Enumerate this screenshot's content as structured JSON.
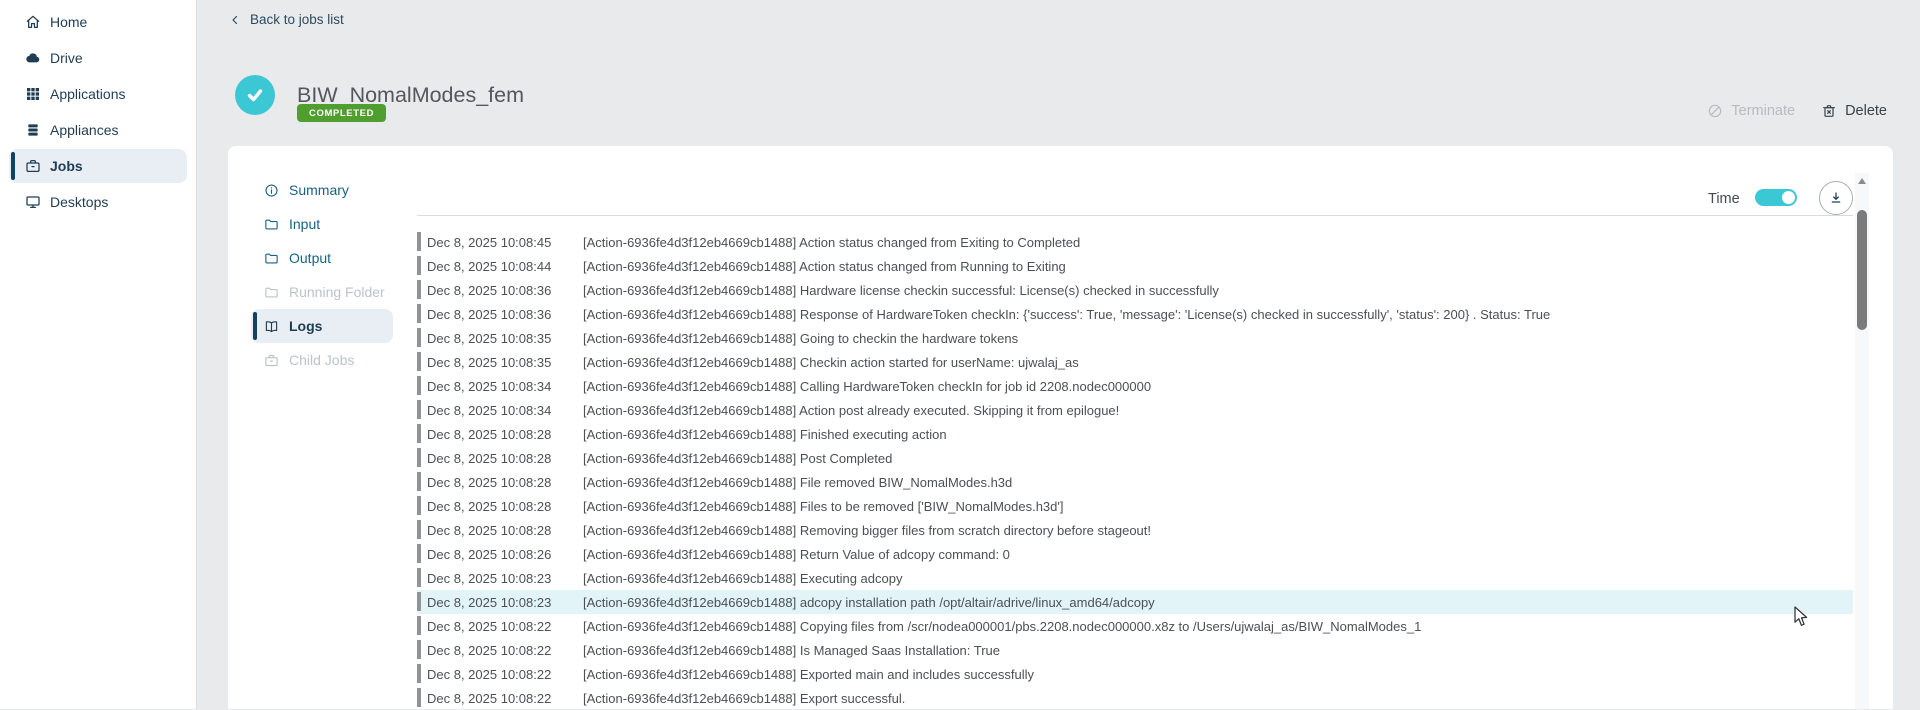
{
  "colors": {
    "accent_teal": "#3cc7d5",
    "badge_green": "#509e2f",
    "nav_navy": "#1f3d54",
    "subnav_link": "#186284",
    "disabled_gray": "#bcc3c9",
    "row_highlight": "#e2f4f7",
    "page_background": "#e9eaeb"
  },
  "sidebar": {
    "items": [
      {
        "label": "Home",
        "icon": "home-icon",
        "active": false
      },
      {
        "label": "Drive",
        "icon": "cloud-icon",
        "active": false
      },
      {
        "label": "Applications",
        "icon": "grid-icon",
        "active": false
      },
      {
        "label": "Appliances",
        "icon": "stack-icon",
        "active": false
      },
      {
        "label": "Jobs",
        "icon": "briefcase-icon",
        "active": true
      },
      {
        "label": "Desktops",
        "icon": "monitor-icon",
        "active": false
      }
    ]
  },
  "breadcrumb": {
    "back_label": "Back to jobs list"
  },
  "job_header": {
    "title": "BIW_NomalModes_fem",
    "status": "COMPLETED",
    "status_icon": "check-circle-icon"
  },
  "actions": {
    "terminate_label": "Terminate",
    "delete_label": "Delete"
  },
  "subnav": {
    "items": [
      {
        "label": "Summary",
        "icon": "info-icon",
        "active": false,
        "disabled": false
      },
      {
        "label": "Input",
        "icon": "folder-icon",
        "active": false,
        "disabled": false
      },
      {
        "label": "Output",
        "icon": "folder-icon",
        "active": false,
        "disabled": false
      },
      {
        "label": "Running Folder",
        "icon": "folder-icon",
        "active": false,
        "disabled": true
      },
      {
        "label": "Logs",
        "icon": "book-icon",
        "active": true,
        "disabled": false
      },
      {
        "label": "Child Jobs",
        "icon": "briefcase-icon",
        "active": false,
        "disabled": true
      }
    ]
  },
  "toolbar": {
    "time_label": "Time",
    "time_toggle_on": true,
    "download_icon": "download-icon"
  },
  "logs": [
    {
      "timestamp": "Dec 8, 2025 10:08:45",
      "message": "[Action-6936fe4d3f12eb4669cb1488] Action status changed from Exiting to Completed",
      "highlighted": false
    },
    {
      "timestamp": "Dec 8, 2025 10:08:44",
      "message": "[Action-6936fe4d3f12eb4669cb1488] Action status changed from Running to Exiting",
      "highlighted": false
    },
    {
      "timestamp": "Dec 8, 2025 10:08:36",
      "message": "[Action-6936fe4d3f12eb4669cb1488] Hardware license checkin successful: License(s) checked in successfully",
      "highlighted": false
    },
    {
      "timestamp": "Dec 8, 2025 10:08:36",
      "message": "[Action-6936fe4d3f12eb4669cb1488] Response of HardwareToken checkIn: {'success': True, 'message': 'License(s) checked in successfully', 'status': 200} . Status:  True",
      "highlighted": false
    },
    {
      "timestamp": "Dec 8, 2025 10:08:35",
      "message": "[Action-6936fe4d3f12eb4669cb1488] Going to checkin the hardware tokens",
      "highlighted": false
    },
    {
      "timestamp": "Dec 8, 2025 10:08:35",
      "message": "[Action-6936fe4d3f12eb4669cb1488] Checkin action started for userName: ujwalaj_as",
      "highlighted": false
    },
    {
      "timestamp": "Dec 8, 2025 10:08:34",
      "message": "[Action-6936fe4d3f12eb4669cb1488] Calling HardwareToken checkIn for job id 2208.nodec000000",
      "highlighted": false
    },
    {
      "timestamp": "Dec 8, 2025 10:08:34",
      "message": "[Action-6936fe4d3f12eb4669cb1488] Action post already executed. Skipping it from epilogue!",
      "highlighted": false
    },
    {
      "timestamp": "Dec 8, 2025 10:08:28",
      "message": "[Action-6936fe4d3f12eb4669cb1488] Finished executing action",
      "highlighted": false
    },
    {
      "timestamp": "Dec 8, 2025 10:08:28",
      "message": "[Action-6936fe4d3f12eb4669cb1488] Post Completed",
      "highlighted": false
    },
    {
      "timestamp": "Dec 8, 2025 10:08:28",
      "message": "[Action-6936fe4d3f12eb4669cb1488] File removed BIW_NomalModes.h3d",
      "highlighted": false
    },
    {
      "timestamp": "Dec 8, 2025 10:08:28",
      "message": "[Action-6936fe4d3f12eb4669cb1488] Files to be removed ['BIW_NomalModes.h3d']",
      "highlighted": false
    },
    {
      "timestamp": "Dec 8, 2025 10:08:28",
      "message": "[Action-6936fe4d3f12eb4669cb1488] Removing bigger files from scratch directory before stageout!",
      "highlighted": false
    },
    {
      "timestamp": "Dec 8, 2025 10:08:26",
      "message": "[Action-6936fe4d3f12eb4669cb1488] Return Value of adcopy command: 0",
      "highlighted": false
    },
    {
      "timestamp": "Dec 8, 2025 10:08:23",
      "message": "[Action-6936fe4d3f12eb4669cb1488] Executing adcopy",
      "highlighted": false
    },
    {
      "timestamp": "Dec 8, 2025 10:08:23",
      "message": "[Action-6936fe4d3f12eb4669cb1488] adcopy installation path /opt/altair/adrive/linux_amd64/adcopy",
      "highlighted": true
    },
    {
      "timestamp": "Dec 8, 2025 10:08:22",
      "message": "[Action-6936fe4d3f12eb4669cb1488] Copying files from /scr/nodea000001/pbs.2208.nodec000000.x8z to /Users/ujwalaj_as/BIW_NomalModes_1",
      "highlighted": false
    },
    {
      "timestamp": "Dec 8, 2025 10:08:22",
      "message": "[Action-6936fe4d3f12eb4669cb1488] Is Managed Saas Installation: True",
      "highlighted": false
    },
    {
      "timestamp": "Dec 8, 2025 10:08:22",
      "message": "[Action-6936fe4d3f12eb4669cb1488] Exported main and includes successfully",
      "highlighted": false
    },
    {
      "timestamp": "Dec 8, 2025 10:08:22",
      "message": "[Action-6936fe4d3f12eb4669cb1488] Export successful.",
      "highlighted": false
    }
  ]
}
